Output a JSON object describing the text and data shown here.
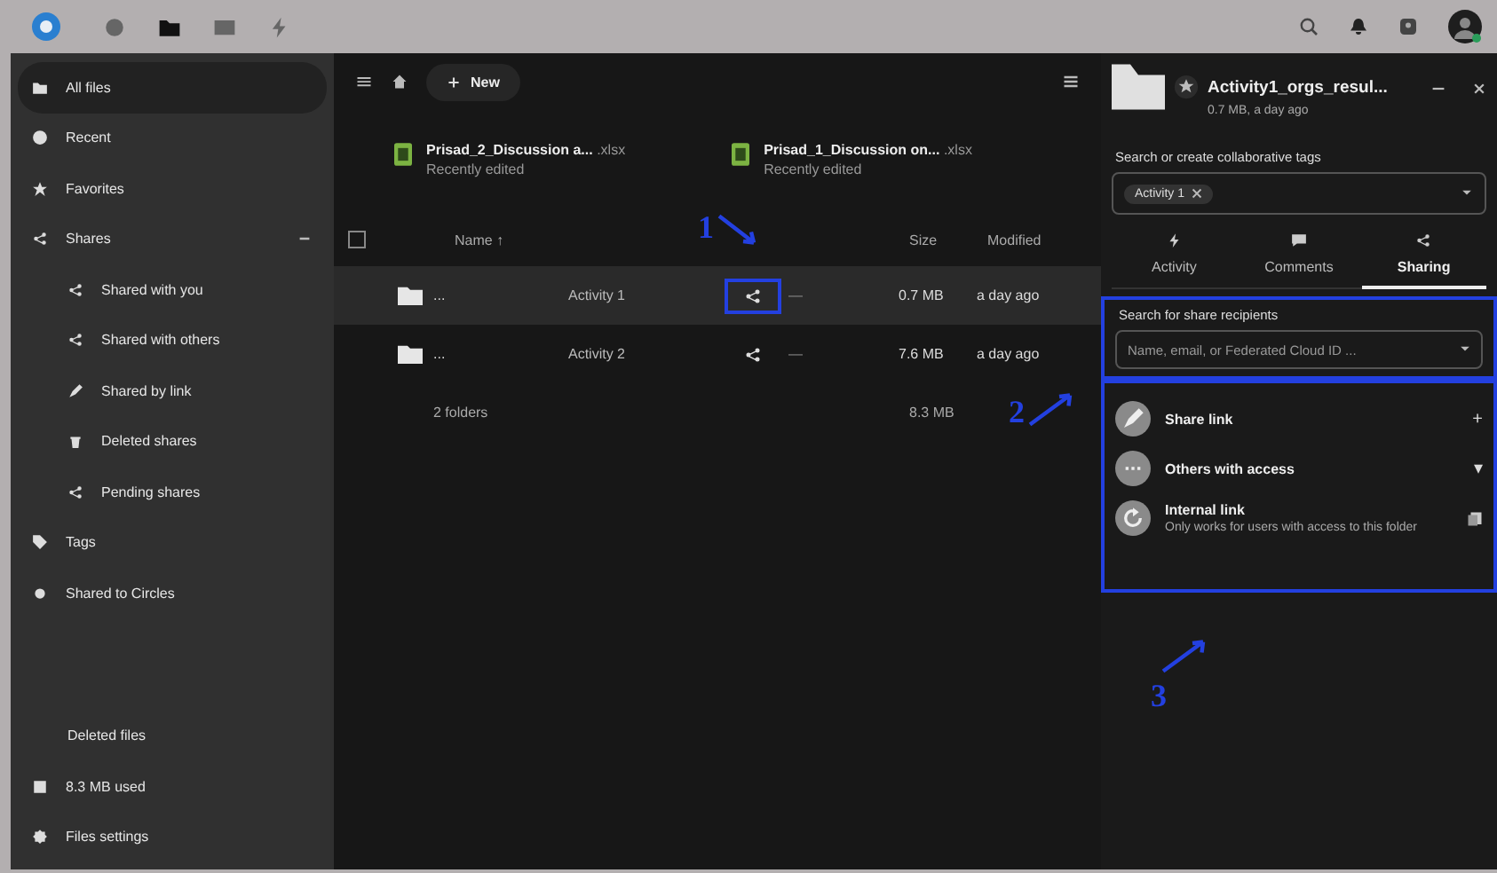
{
  "topbar": {
    "apps": [
      {
        "kind": "dashboard",
        "selected": false
      },
      {
        "kind": "files",
        "selected": true
      },
      {
        "kind": "photos",
        "selected": false
      },
      {
        "kind": "activity",
        "selected": false
      }
    ]
  },
  "sidebar": {
    "items": [
      {
        "label": "All files",
        "selected": true
      },
      {
        "label": "Recent",
        "selected": false
      },
      {
        "label": "Favorites",
        "selected": false
      },
      {
        "label": "Shares",
        "selected": false,
        "expanded": true,
        "children": [
          {
            "label": "Shared with you",
            "selected": false
          },
          {
            "label": "Shared with others",
            "selected": false
          },
          {
            "label": "Shared by link",
            "selected": false
          },
          {
            "label": "Deleted shares",
            "selected": false
          },
          {
            "label": "Pending shares",
            "selected": false
          }
        ]
      },
      {
        "label": "Tags",
        "selected": false
      },
      {
        "label": "Shared to Circles",
        "selected": false
      }
    ],
    "footer": [
      "Deleted files",
      "8.3 MB used",
      "Files settings"
    ]
  },
  "toolbar": {
    "new_button": "New"
  },
  "recent": [
    {
      "name": "Prisad_2_Discussion a...",
      "ext": ".xlsx",
      "note": "Recently edited"
    },
    {
      "name": "Prisad_1_Discussion on...",
      "ext": ".xlsx",
      "note": "Recently edited"
    }
  ],
  "table": {
    "select_all": {
      "checked": false
    },
    "columns": [
      "Name ↑",
      "Size",
      "Modified"
    ],
    "rows": [
      {
        "name": "...",
        "label": "Activity 1",
        "shares": "—",
        "size": "0.7 MB",
        "modified": "a day ago",
        "selected": true,
        "highlighted": true
      },
      {
        "name": "...",
        "label": "Activity 2",
        "shares": "—",
        "size": "7.6 MB",
        "modified": "a day ago",
        "selected": false,
        "highlighted": false
      }
    ],
    "summary": {
      "count": "2 folders",
      "size": "8.3 MB"
    }
  },
  "details": {
    "title": "Activity1_orgs_resul...",
    "meta": "0.7 MB, a day ago",
    "tags_label": "Search or create collaborative tags",
    "tags": [
      "Activity 1"
    ],
    "tabs": [
      {
        "label": "Activity",
        "selected": false
      },
      {
        "label": "Comments",
        "selected": false
      },
      {
        "label": "Sharing",
        "selected": true
      }
    ],
    "search": {
      "label": "Search for share recipients",
      "placeholder": "Name, email, or Federated Cloud ID ...",
      "highlighted": true
    },
    "share_entries": [
      {
        "title": "Share link",
        "action": "+"
      },
      {
        "title": "Others with access",
        "action": "▾"
      },
      {
        "title": "Internal link",
        "subtitle": "Only works for users with access to this folder"
      }
    ],
    "entries_highlighted": true
  },
  "annotations": [
    {
      "label": "1"
    },
    {
      "label": "2"
    },
    {
      "label": "3"
    }
  ]
}
